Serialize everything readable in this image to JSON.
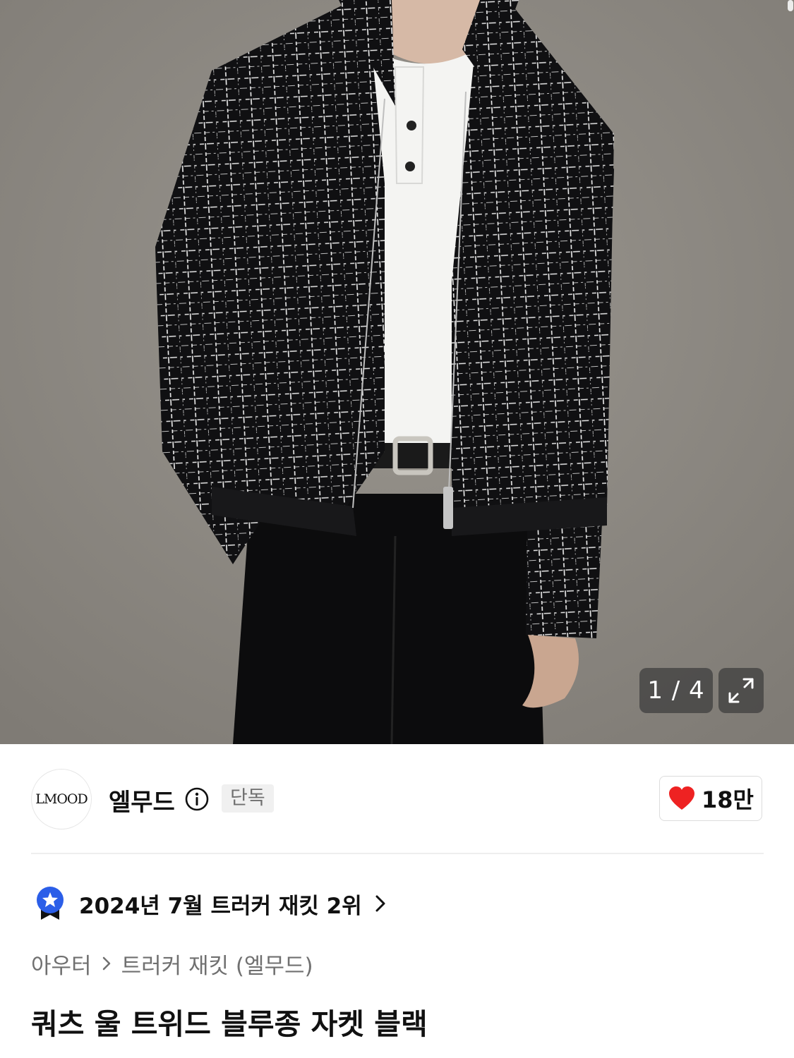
{
  "gallery": {
    "counter": "1 / 4",
    "current": 1,
    "total": 4
  },
  "brand": {
    "logo_text": "LMOOD",
    "name": "엘무드",
    "badge": "단독"
  },
  "like": {
    "count": "18만"
  },
  "ranking": {
    "text": "2024년 7월 트러커 재킷 2위"
  },
  "breadcrumb": {
    "items": [
      "아우터",
      "트러커 재킷 (엘무드)"
    ]
  },
  "product": {
    "title": "쿼츠 울 트위드 블루종 자켓 블랙"
  },
  "colors": {
    "like_heart": "#ee2222",
    "rank_badge": "#2b5ee8"
  }
}
